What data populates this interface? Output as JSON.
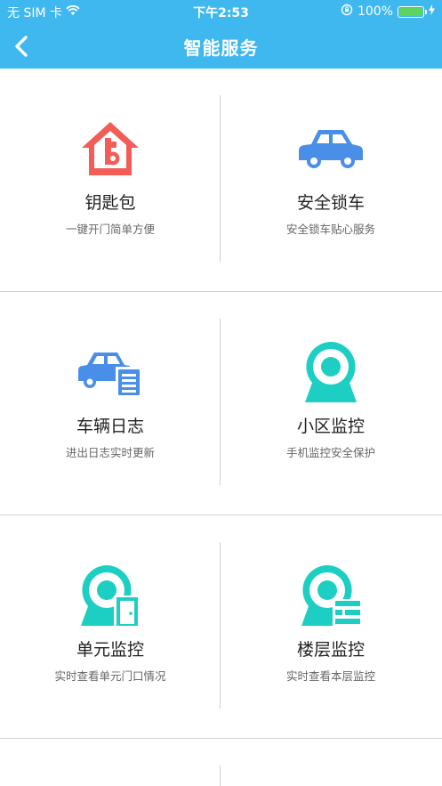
{
  "status_bar": {
    "carrier": "无 SIM 卡",
    "time": "下午2:53",
    "battery_percent": "100%",
    "battery_level": 1.0
  },
  "nav": {
    "title": "智能服务",
    "back_icon": "chevron-left-icon"
  },
  "services": [
    {
      "title": "钥匙包",
      "subtitle": "一键开门简单方便",
      "icon": "house-key-icon",
      "color": "#f25d58"
    },
    {
      "title": "安全锁车",
      "subtitle": "安全锁车贴心服务",
      "icon": "car-icon",
      "color": "#4a8fe7"
    },
    {
      "title": "车辆日志",
      "subtitle": "进出日志实时更新",
      "icon": "car-log-icon",
      "color": "#4a8fe7"
    },
    {
      "title": "小区监控",
      "subtitle": "手机监控安全保护",
      "icon": "camera-icon",
      "color": "#1ccfc2"
    },
    {
      "title": "单元监控",
      "subtitle": "实时查看单元门口情况",
      "icon": "camera-door-icon",
      "color": "#1ccfc2"
    },
    {
      "title": "楼层监控",
      "subtitle": "实时查看本层监控",
      "icon": "camera-floor-icon",
      "color": "#1ccfc2"
    }
  ],
  "colors": {
    "header": "#3fb8ef",
    "red": "#f25d58",
    "blue": "#4a8fe7",
    "teal": "#1ccfc2"
  }
}
